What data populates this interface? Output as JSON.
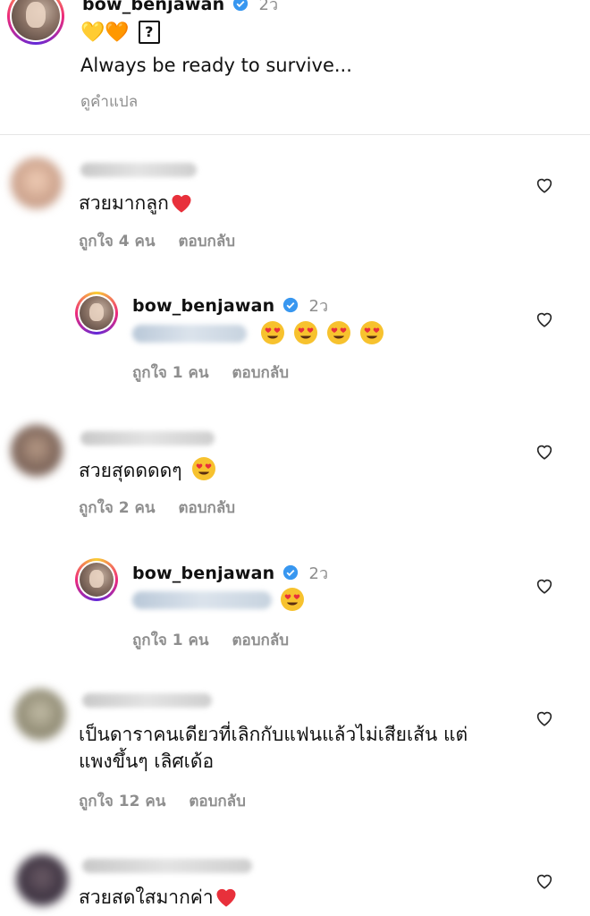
{
  "post": {
    "username": "bow_benjawan",
    "time": "2ว",
    "caption_emoji": "💛🧡",
    "caption_box": "?",
    "caption": "Always be ready to survive...",
    "translate": "ดูคำแปล"
  },
  "comments": [
    {
      "text": "สวยมากลูก",
      "emoji_tail": "heart",
      "likes": "ถูกใจ 4 คน",
      "reply": "ตอบกลับ"
    },
    {
      "username": "bow_benjawan",
      "time": "2ว",
      "emoji_count": 4,
      "likes": "ถูกใจ 1 คน",
      "reply": "ตอบกลับ"
    },
    {
      "text": "สวยสุดดดดๆ",
      "likes": "ถูกใจ 2 คน",
      "reply": "ตอบกลับ"
    },
    {
      "username": "bow_benjawan",
      "time": "2ว",
      "emoji_count": 1,
      "likes": "ถูกใจ 1 คน",
      "reply": "ตอบกลับ"
    },
    {
      "text_line1": "เป็นดาราคนเดียวที่เลิกกับแฟนแล้วไม่เสียเส้น แต่",
      "text_line2": "แพงขึ้นๆ เลิศเด้อ",
      "likes": "ถูกใจ 12 คน",
      "reply": "ตอบกลับ"
    },
    {
      "text": "สวยสดใสมากค่า",
      "emoji_tail": "heart"
    }
  ],
  "colors": {
    "verified": "#3897f0",
    "heart_red": "#e8303b",
    "muted": "#8e8e8e"
  },
  "icons": [
    "verified-icon",
    "like-heart-icon",
    "heart-eyes-emoji",
    "red-heart-emoji"
  ]
}
